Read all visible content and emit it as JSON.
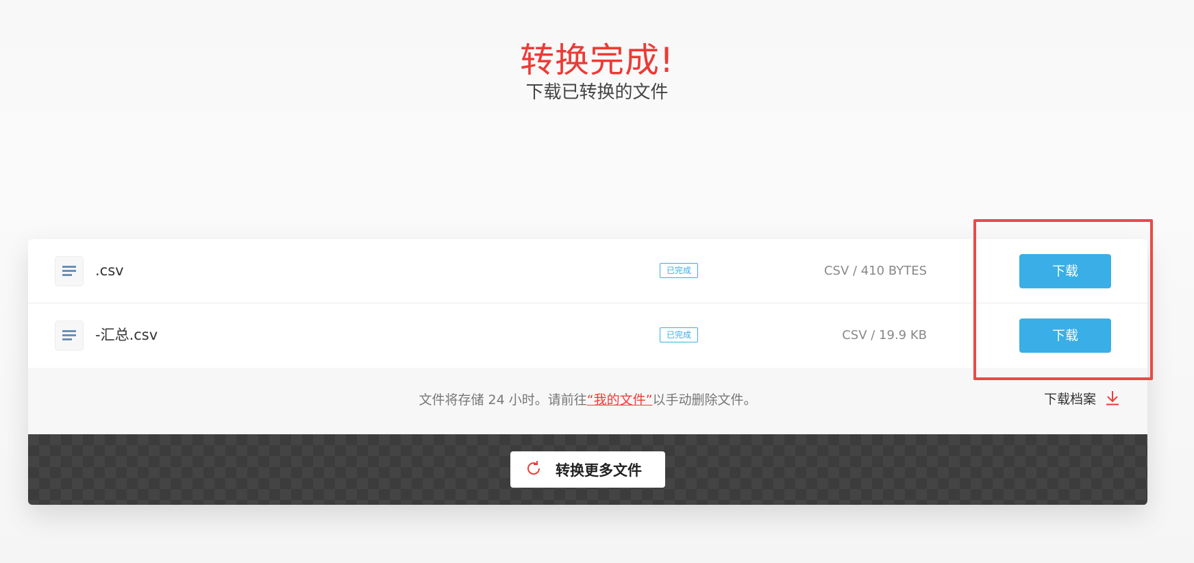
{
  "hero": {
    "title": "转换完成!",
    "subtitle": "下载已转换的文件"
  },
  "files": [
    {
      "name": ".csv",
      "status": "已完成",
      "meta": "CSV / 410 BYTES",
      "download_label": "下载",
      "icon": "file-text-icon"
    },
    {
      "name": "-汇总.csv",
      "status": "已完成",
      "meta": "CSV / 19.9 KB",
      "download_label": "下载",
      "icon": "file-text-icon"
    }
  ],
  "info": {
    "text_before": "文件将存储 24 小时。请前往",
    "link_text": "“我的文件”",
    "text_after": "以手动删除文件。",
    "archive_label": "下载档案",
    "archive_icon": "download-arrow-icon"
  },
  "footer": {
    "convert_more_label": "转换更多文件",
    "convert_more_icon": "refresh-icon"
  },
  "colors": {
    "accent_red": "#ee3a35",
    "download_blue": "#3aaee6",
    "status_blue": "#3aaee0",
    "highlight_red": "#e84a46",
    "footer_dark": "#444444"
  }
}
